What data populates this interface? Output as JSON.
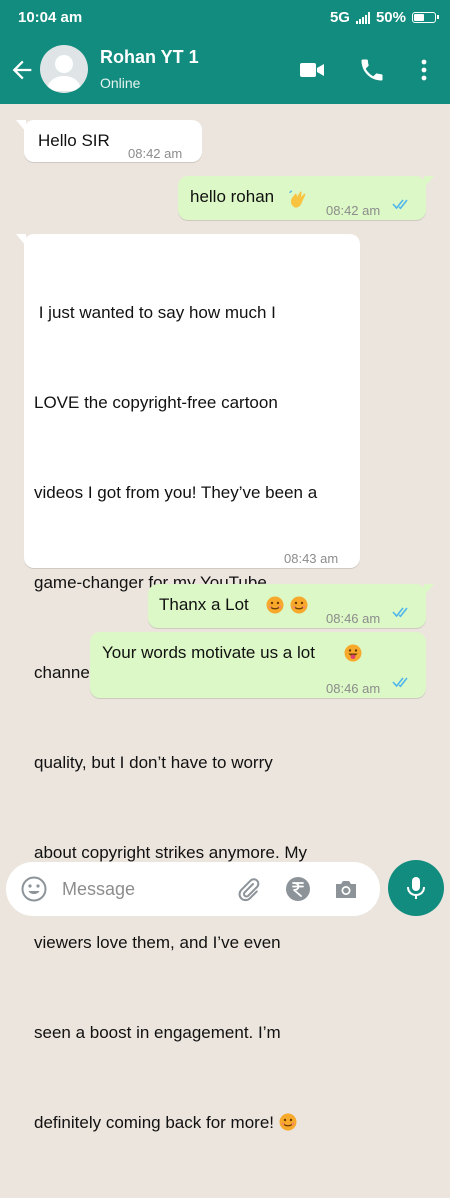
{
  "statusbar": {
    "time": "10:04 am",
    "network": "5G",
    "battery": "50%",
    "battery_level": 0.5
  },
  "header": {
    "contact_name": "Rohan YT 1",
    "status": "Online"
  },
  "messages": [
    {
      "direction": "in",
      "text": "Hello SIR",
      "time": "08:42 am"
    },
    {
      "direction": "out",
      "text": "hello rohan",
      "emoji": "waving-hand",
      "time": "08:42 am",
      "read": true
    },
    {
      "direction": "in",
      "lines": [
        " I just wanted to say how much I",
        "LOVE the copyright-free cartoon",
        "videos I got from you! They’ve been a",
        "game-changer for my YouTube",
        "channel. Not only are they super high",
        "quality, but I don’t have to worry",
        "about copyright strikes anymore. My",
        "viewers love them, and I’ve even",
        "seen a boost in engagement. I’m",
        "definitely coming back for more!"
      ],
      "emoji": "smiling-face",
      "time": "08:43 am"
    },
    {
      "direction": "out",
      "text": "Thanx a Lot",
      "emoji": "smiling-face x2",
      "time": "08:46 am",
      "read": true
    },
    {
      "direction": "out",
      "text": "Your words motivate us a lot",
      "emoji": "tongue-face",
      "time": "08:46 am",
      "read": true
    }
  ],
  "input": {
    "placeholder": "Message"
  },
  "colors": {
    "header": "#128c7e",
    "outgoing": "#dcf8c6",
    "incoming": "#ffffff",
    "read_tick": "#4fb6ec"
  }
}
